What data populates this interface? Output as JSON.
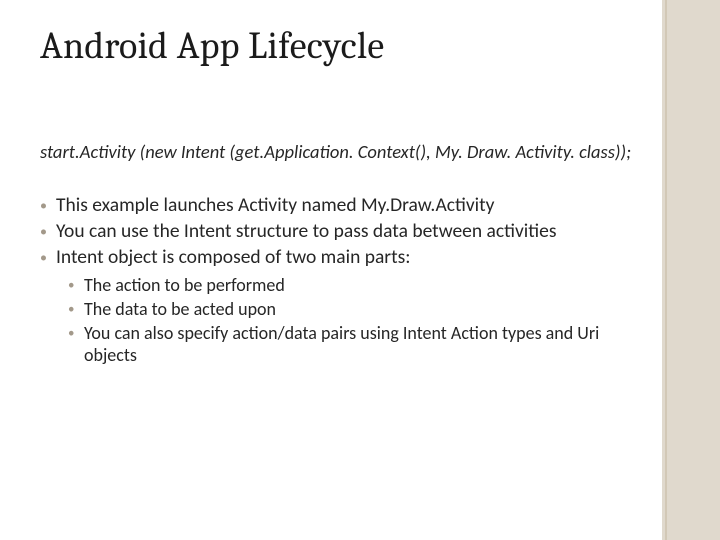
{
  "title": "Android App Lifecycle",
  "code": "start.Activity (new Intent (get.Application. Context(), My. Draw. Activity. class));",
  "bullets": [
    "This example launches Activity named My.Draw.Activity",
    "You can use the Intent structure to pass data between activities",
    "Intent object is composed of two main parts:"
  ],
  "subbullets": [
    "The action to be performed",
    "The data to be acted upon",
    "You can also specify action/data pairs using Intent Action types and Uri objects"
  ]
}
